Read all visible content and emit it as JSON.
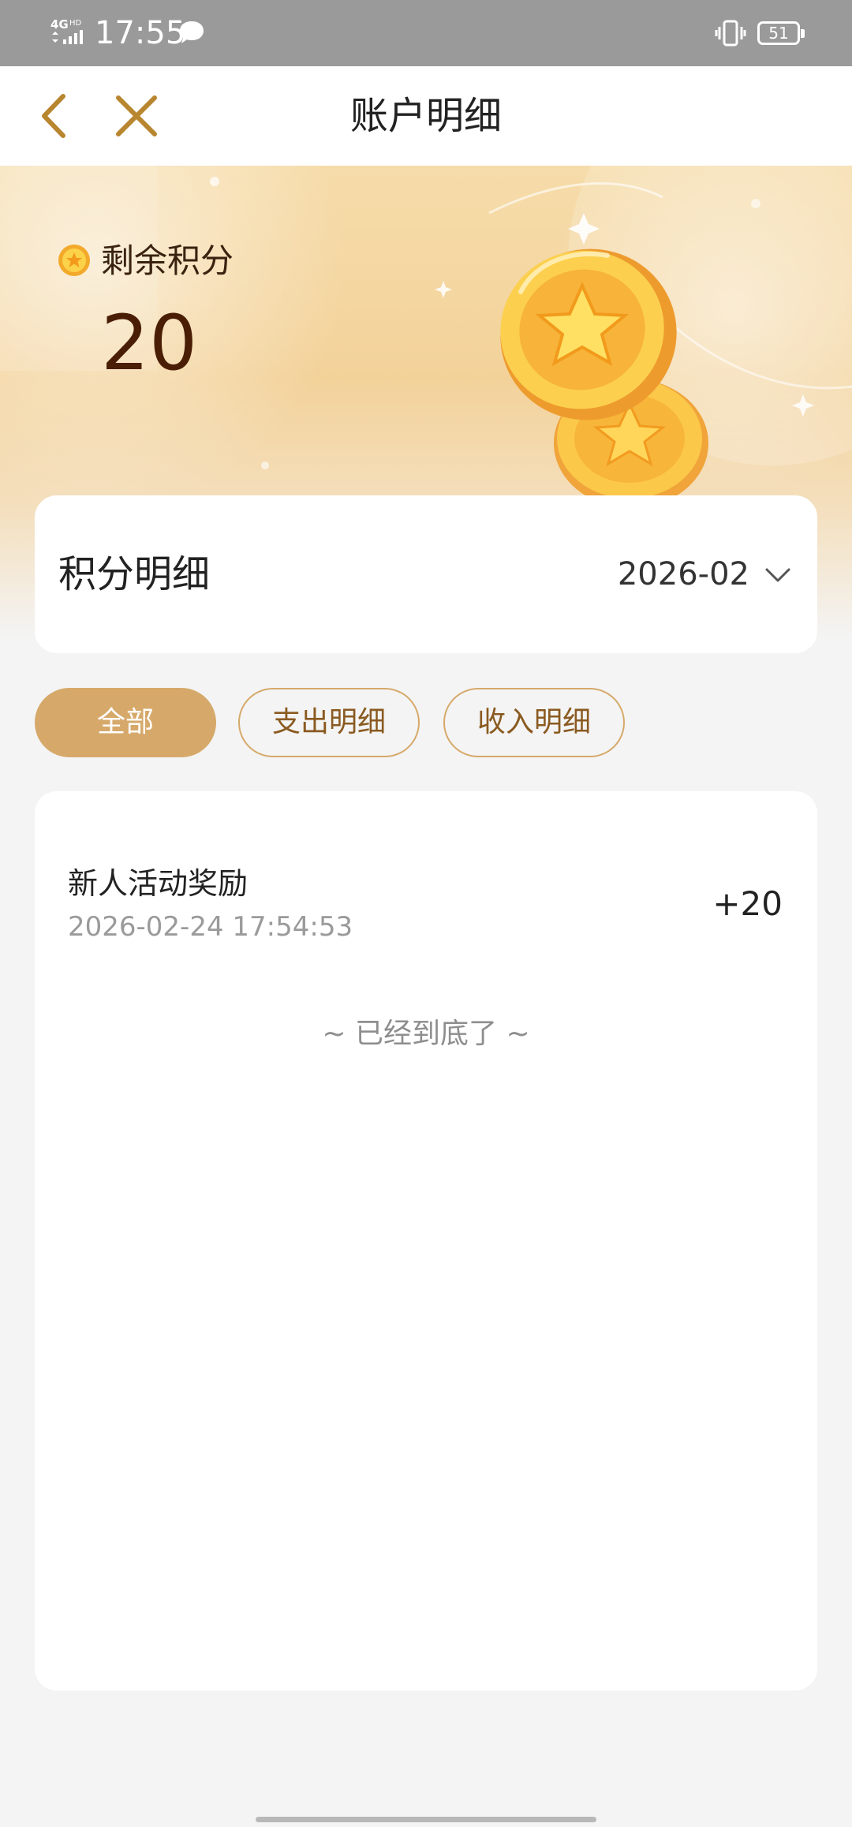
{
  "status_bar": {
    "network": "4GHD",
    "time": "17:55",
    "battery": "51",
    "icons": [
      "signal-icon",
      "message-icon",
      "vibrate-icon",
      "battery-icon"
    ]
  },
  "nav": {
    "title": "账户明细",
    "back_icon": "chevron-left-icon",
    "close_icon": "close-icon"
  },
  "hero": {
    "label": "剩余积分",
    "points": "20"
  },
  "detail_header": {
    "title": "积分明细",
    "month": "2026-02"
  },
  "filters": [
    {
      "label": "全部",
      "active": true
    },
    {
      "label": "支出明细",
      "active": false
    },
    {
      "label": "收入明细",
      "active": false
    }
  ],
  "records": [
    {
      "title": "新人活动奖励",
      "time": "2026-02-24 17:54:53",
      "amount": "+20"
    }
  ],
  "list_end_text": "~ 已经到底了 ~",
  "colors": {
    "accent": "#d6a96a",
    "accent_dark": "#b8862f",
    "points_text": "#4a1e05"
  }
}
